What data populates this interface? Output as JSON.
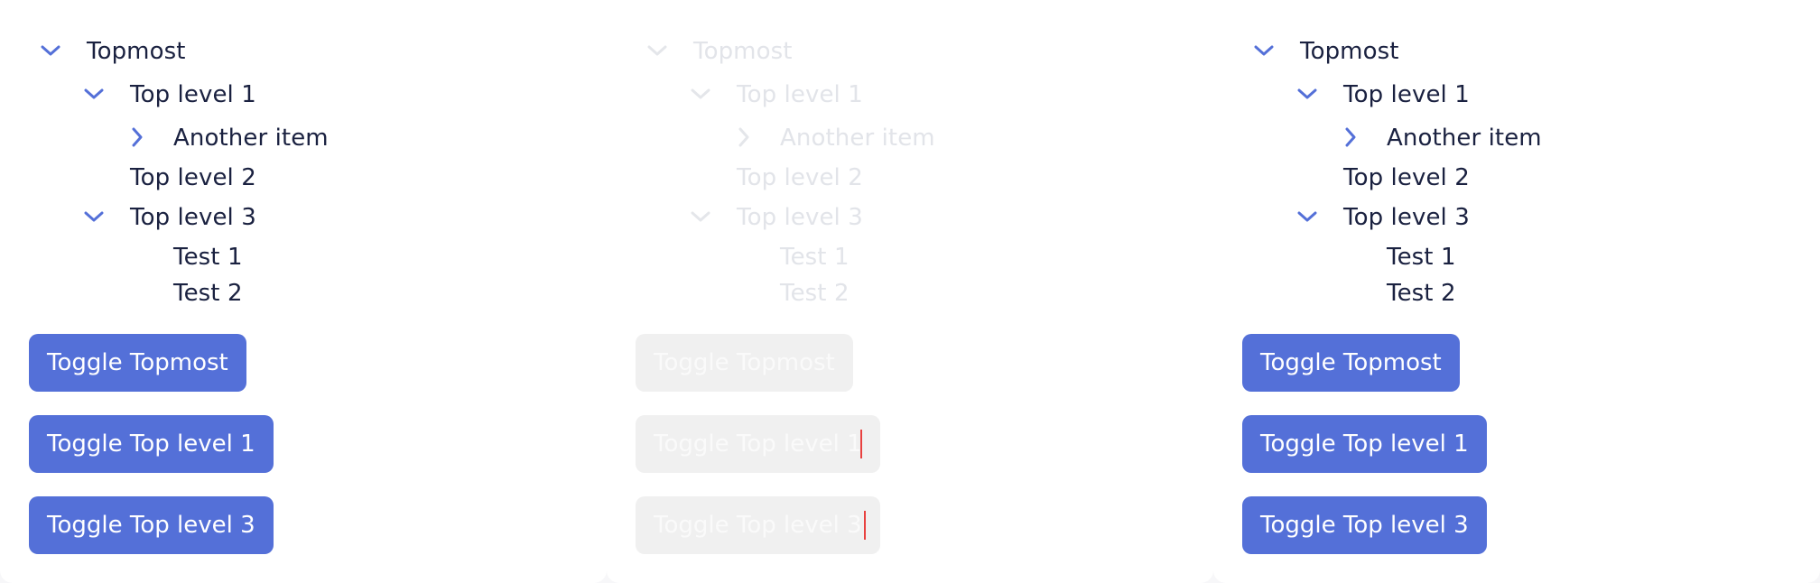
{
  "colors": {
    "accent": "#5470d8",
    "text": "#1a2140",
    "disabled_text": "#e2e4e9",
    "disabled_button": "#f0f0f0",
    "focus_marker": "#e8413f"
  },
  "panels": [
    {
      "state": "enabled",
      "tree": {
        "topmost": "Topmost",
        "top_level_1": "Top level 1",
        "another_item": "Another item",
        "top_level_2": "Top level 2",
        "top_level_3": "Top level 3",
        "test_1": "Test 1",
        "test_2": "Test 2"
      },
      "buttons": {
        "toggle_topmost": "Toggle Topmost",
        "toggle_top_level_1": "Toggle Top level 1",
        "toggle_top_level_3": "Toggle Top level 3"
      }
    },
    {
      "state": "disabled",
      "tree": {
        "topmost": "Topmost",
        "top_level_1": "Top level 1",
        "another_item": "Another item",
        "top_level_2": "Top level 2",
        "top_level_3": "Top level 3",
        "test_1": "Test 1",
        "test_2": "Test 2"
      },
      "buttons": {
        "toggle_topmost": "Toggle Topmost",
        "toggle_top_level_1": "Toggle Top level 1",
        "toggle_top_level_3": "Toggle Top level 3"
      }
    },
    {
      "state": "enabled",
      "tree": {
        "topmost": "Topmost",
        "top_level_1": "Top level 1",
        "another_item": "Another item",
        "top_level_2": "Top level 2",
        "top_level_3": "Top level 3",
        "test_1": "Test 1",
        "test_2": "Test 2"
      },
      "buttons": {
        "toggle_topmost": "Toggle Topmost",
        "toggle_top_level_1": "Toggle Top level 1",
        "toggle_top_level_3": "Toggle Top level 3"
      }
    }
  ],
  "icons": {
    "expanded": "chevron-down-icon",
    "collapsed": "chevron-right-icon"
  }
}
